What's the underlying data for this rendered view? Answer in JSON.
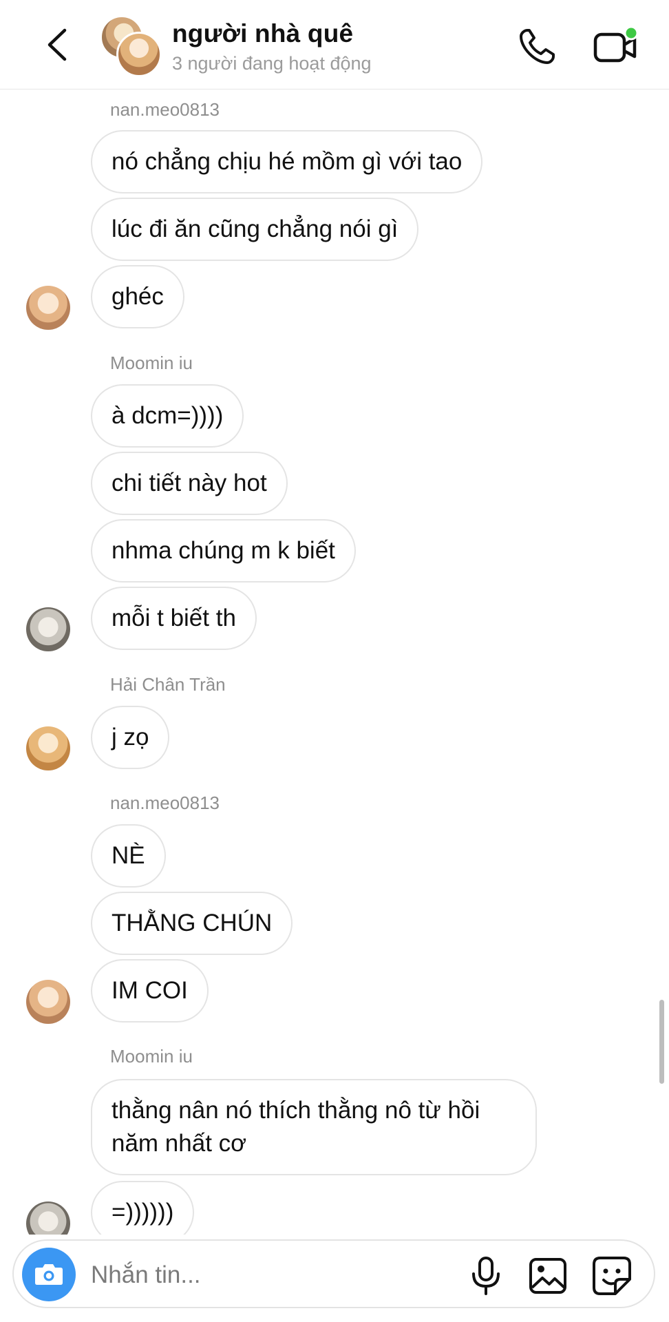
{
  "header": {
    "title": "người nhà quê",
    "subtitle": "3 người đang hoạt động"
  },
  "colors": {
    "accent": "#3b97f3",
    "online_dot": "#3ec944",
    "bubble_border": "#e4e4e4",
    "meta_text": "#8e8e8e"
  },
  "messages": {
    "groups": [
      {
        "sender": "nan.meo0813",
        "avatar": "avatar-nan",
        "bubbles": [
          "nó chẳng chịu hé mồm gì với tao",
          "lúc đi ăn cũng chẳng nói gì",
          "ghéc"
        ]
      },
      {
        "sender": "Moomin iu",
        "avatar": "avatar-moomin",
        "bubbles": [
          "à dcm=))))",
          "chi tiết này hot",
          "nhma chúng m k biết",
          "mỗi t biết th"
        ]
      },
      {
        "sender": "Hải Chân Trần",
        "avatar": "avatar-hai",
        "bubbles": [
          "j zọ"
        ]
      },
      {
        "sender": "nan.meo0813",
        "avatar": "avatar-nan",
        "bubbles": [
          "NÈ",
          "THẰNG CHÚN",
          "IM COI"
        ]
      },
      {
        "sender": "Moomin iu",
        "avatar": "avatar-moomin",
        "bubbles": [
          "thằng nân nó thích thằng nô từ hồi năm nhất cơ",
          "=))))))"
        ]
      }
    ]
  },
  "composer": {
    "placeholder": "Nhắn tin...",
    "icons": [
      "camera-icon",
      "microphone-icon",
      "gallery-icon",
      "sticker-icon"
    ]
  }
}
